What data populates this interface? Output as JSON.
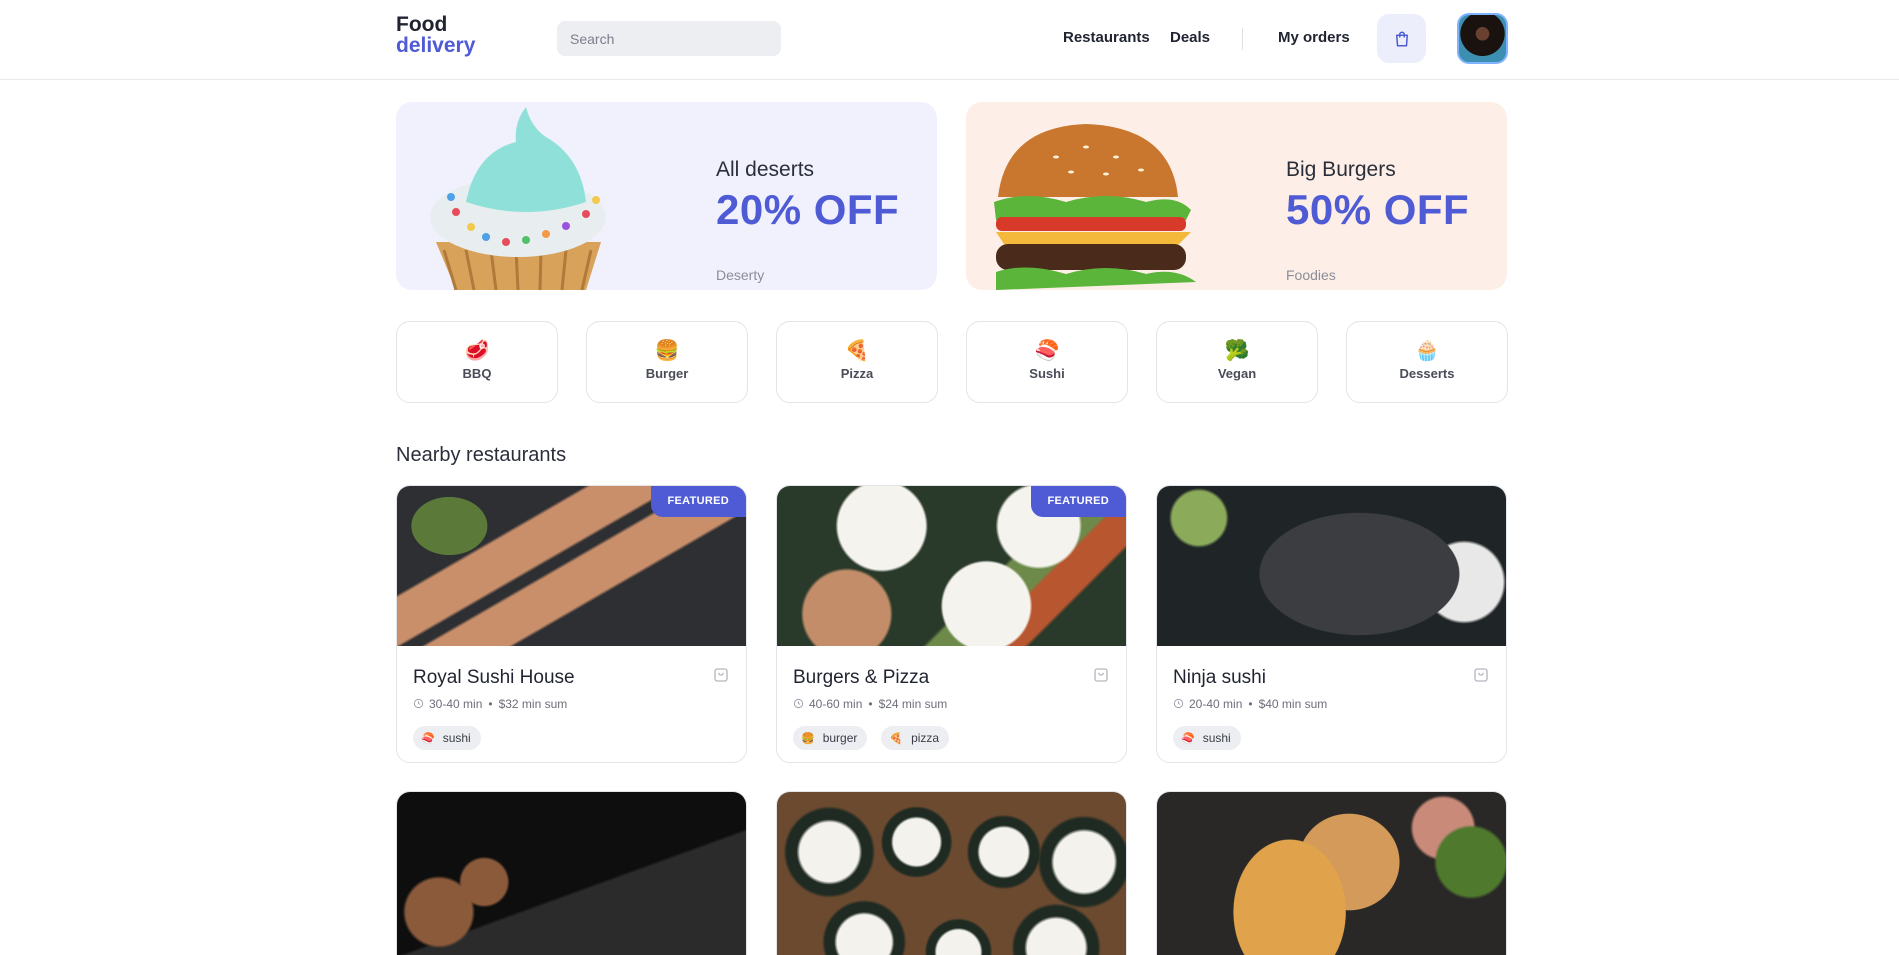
{
  "logo": {
    "line1": "Food",
    "line2": "delivery"
  },
  "search": {
    "placeholder": "Search"
  },
  "nav": {
    "restaurants": "Restaurants",
    "deals": "Deals",
    "my_orders": "My orders"
  },
  "promos": [
    {
      "subtitle": "All deserts",
      "offer": "20% OFF",
      "brand": "Deserty"
    },
    {
      "subtitle": "Big Burgers",
      "offer": "50% OFF",
      "brand": "Foodies"
    }
  ],
  "categories": [
    {
      "emoji": "🥩",
      "label": "BBQ"
    },
    {
      "emoji": "🍔",
      "label": "Burger"
    },
    {
      "emoji": "🍕",
      "label": "Pizza"
    },
    {
      "emoji": "🍣",
      "label": "Sushi"
    },
    {
      "emoji": "🥦",
      "label": "Vegan"
    },
    {
      "emoji": "🧁",
      "label": "Desserts"
    }
  ],
  "section_title": "Nearby restaurants",
  "restaurants": [
    {
      "name": "Royal Sushi House",
      "time": "30-40 min",
      "min_sum": "$32 min sum",
      "badge": "FEATURED",
      "tags": [
        {
          "emoji": "🍣",
          "label": "sushi"
        }
      ]
    },
    {
      "name": "Burgers & Pizza",
      "time": "40-60 min",
      "min_sum": "$24 min sum",
      "badge": "FEATURED",
      "tags": [
        {
          "emoji": "🍔",
          "label": "burger"
        },
        {
          "emoji": "🍕",
          "label": "pizza"
        }
      ]
    },
    {
      "name": "Ninja sushi",
      "time": "20-40 min",
      "min_sum": "$40 min sum",
      "badge": "",
      "tags": [
        {
          "emoji": "🍣",
          "label": "sushi"
        }
      ]
    }
  ],
  "dot": "•",
  "colors": {
    "accent": "#4f5bd5",
    "promo1_bg": "#f1f1fd",
    "promo2_bg": "#fdefe8"
  },
  "icons": {
    "cart": "shopping-bag-icon",
    "clock": "clock-icon"
  }
}
